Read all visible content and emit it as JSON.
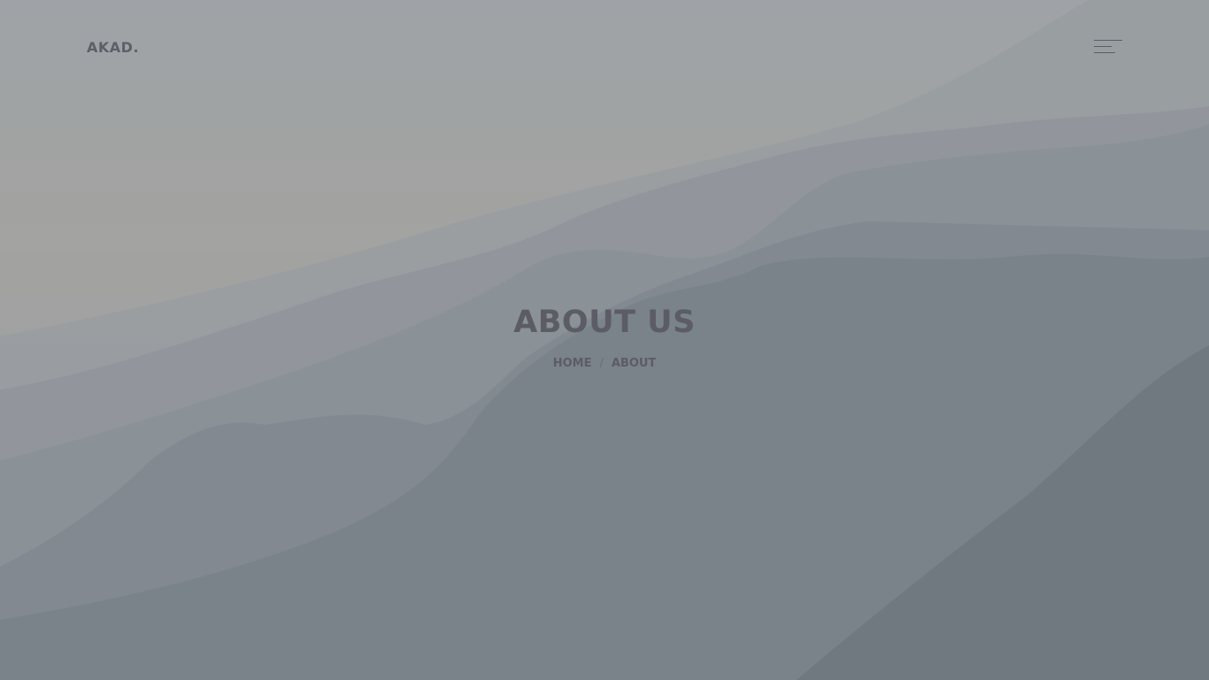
{
  "header": {
    "logo_text": "AKAD.",
    "menu_icon": "hamburger-menu-icon"
  },
  "hero": {
    "title": "ABOUT US",
    "breadcrumb": {
      "home_label": "HOME",
      "separator": "/",
      "current_label": "ABOUT"
    }
  },
  "colors": {
    "text": "#5c5c66",
    "overlay_top": "#a6aaae",
    "overlay_bottom": "#7a8084"
  }
}
